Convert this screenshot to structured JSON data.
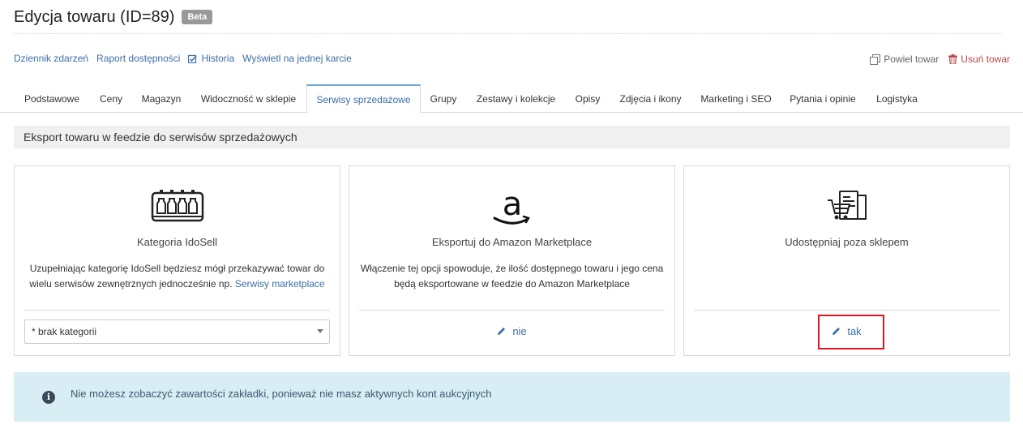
{
  "header": {
    "title": "Edycja towaru (ID=89)",
    "badge": "Beta"
  },
  "links": {
    "event_log": "Dziennik zdarzeń",
    "availability_report": "Raport dostępności",
    "history": "Historia",
    "single_card": "Wyświetl na jednej karcie"
  },
  "actions": {
    "duplicate": "Powiel towar",
    "delete": "Usuń towar"
  },
  "tabs": [
    {
      "label": "Podstawowe"
    },
    {
      "label": "Ceny"
    },
    {
      "label": "Magazyn"
    },
    {
      "label": "Widoczność w sklepie"
    },
    {
      "label": "Serwisy sprzedażowe",
      "active": true
    },
    {
      "label": "Grupy"
    },
    {
      "label": "Zestawy i kolekcje"
    },
    {
      "label": "Opisy"
    },
    {
      "label": "Zdjęcia i ikony"
    },
    {
      "label": "Marketing i SEO"
    },
    {
      "label": "Pytania i opinie"
    },
    {
      "label": "Logistyka"
    }
  ],
  "section": {
    "title": "Eksport towaru w feedzie do serwisów sprzedażowych"
  },
  "cards": {
    "idosell": {
      "title": "Kategoria IdoSell",
      "desc_prefix": "Uzupełniając kategorię IdoSell będziesz mógł przekazywać towar do wielu serwisów zewnętrznych jednocześnie np.",
      "desc_link": "Serwisy marketplace",
      "select_value": "* brak kategorii"
    },
    "amazon": {
      "title": "Eksportuj do Amazon Marketplace",
      "desc": "Włączenie tej opcji spowoduje, że ilość dostępnego towaru i jego cena będą eksportowane w feedzie do Amazon Marketplace",
      "value": "nie"
    },
    "share": {
      "title": "Udostępniaj poza sklepem",
      "value": "tak"
    }
  },
  "info": {
    "icon_glyph": "i",
    "text": "Nie możesz zobaczyć zawartości zakładki, ponieważ nie masz aktywnych kont aukcyjnych"
  },
  "colors": {
    "link": "#3b6fa6",
    "active_tab_border": "#6ea4d6",
    "delete": "#b64a4a",
    "highlight": "#e0141e",
    "info_bg": "#d9edf5"
  }
}
